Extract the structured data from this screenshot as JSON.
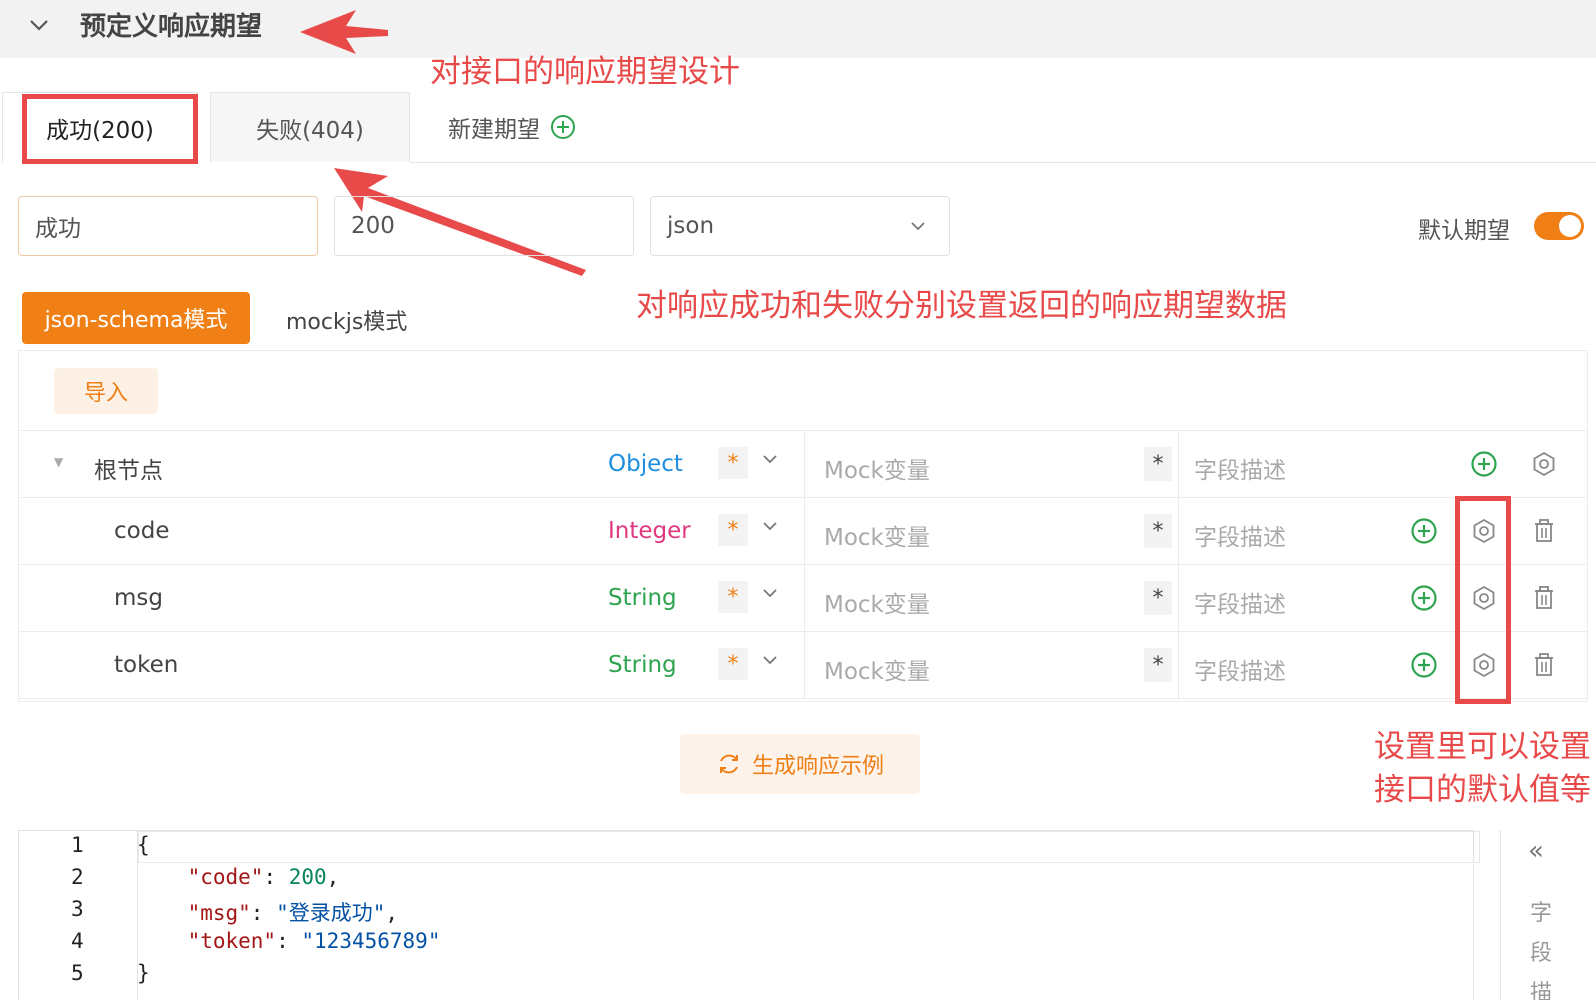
{
  "header": {
    "title": "预定义响应期望"
  },
  "annotations": {
    "design": "对接口的响应期望设计",
    "success_fail": "对响应成功和失败分别设置返回的响应期望数据",
    "settings": "设置里可以设置接口的默认值等"
  },
  "tabs": [
    {
      "label": "成功(200)",
      "active": true
    },
    {
      "label": "失败(404)",
      "active": false
    }
  ],
  "new_tab_label": "新建期望",
  "expectation": {
    "name": "成功",
    "code": "200",
    "content_type": "json",
    "default_label": "默认期望",
    "default_on": true
  },
  "modes": {
    "active": "json-schema模式",
    "inactive": "mockjs模式"
  },
  "import_label": "导入",
  "schema": {
    "mock_placeholder": "Mock变量",
    "desc_placeholder": "字段描述",
    "required_mark": "*",
    "star_mark": "*",
    "rows": [
      {
        "name": "根节点",
        "type": "Object",
        "type_color": "#1e8fe0",
        "root": true
      },
      {
        "name": "code",
        "type": "Integer",
        "type_color": "#e0387e",
        "root": false
      },
      {
        "name": "msg",
        "type": "String",
        "type_color": "#2ea44f",
        "root": false
      },
      {
        "name": "token",
        "type": "String",
        "type_color": "#2ea44f",
        "root": false
      }
    ]
  },
  "generate_label": "生成响应示例",
  "editor": {
    "line_numbers": [
      "1",
      "2",
      "3",
      "4",
      "5"
    ],
    "lines": [
      [
        {
          "t": "{",
          "c": ""
        }
      ],
      [
        {
          "t": "    ",
          "c": ""
        },
        {
          "t": "\"code\"",
          "c": "k"
        },
        {
          "t": ": ",
          "c": ""
        },
        {
          "t": "200",
          "c": "n"
        },
        {
          "t": ",",
          "c": ""
        }
      ],
      [
        {
          "t": "    ",
          "c": ""
        },
        {
          "t": "\"msg\"",
          "c": "k"
        },
        {
          "t": ": ",
          "c": ""
        },
        {
          "t": "\"登录成功\"",
          "c": "s"
        },
        {
          "t": ",",
          "c": ""
        }
      ],
      [
        {
          "t": "    ",
          "c": ""
        },
        {
          "t": "\"token\"",
          "c": "k"
        },
        {
          "t": ": ",
          "c": ""
        },
        {
          "t": "\"123456789\"",
          "c": "s"
        }
      ],
      [
        {
          "t": "}",
          "c": ""
        }
      ]
    ]
  },
  "side_panel": {
    "collapse_icon": "«",
    "label": "字段描"
  },
  "colors": {
    "accent": "#f07f16",
    "annotation": "#e84a4a",
    "add_green": "#2ea44f"
  }
}
